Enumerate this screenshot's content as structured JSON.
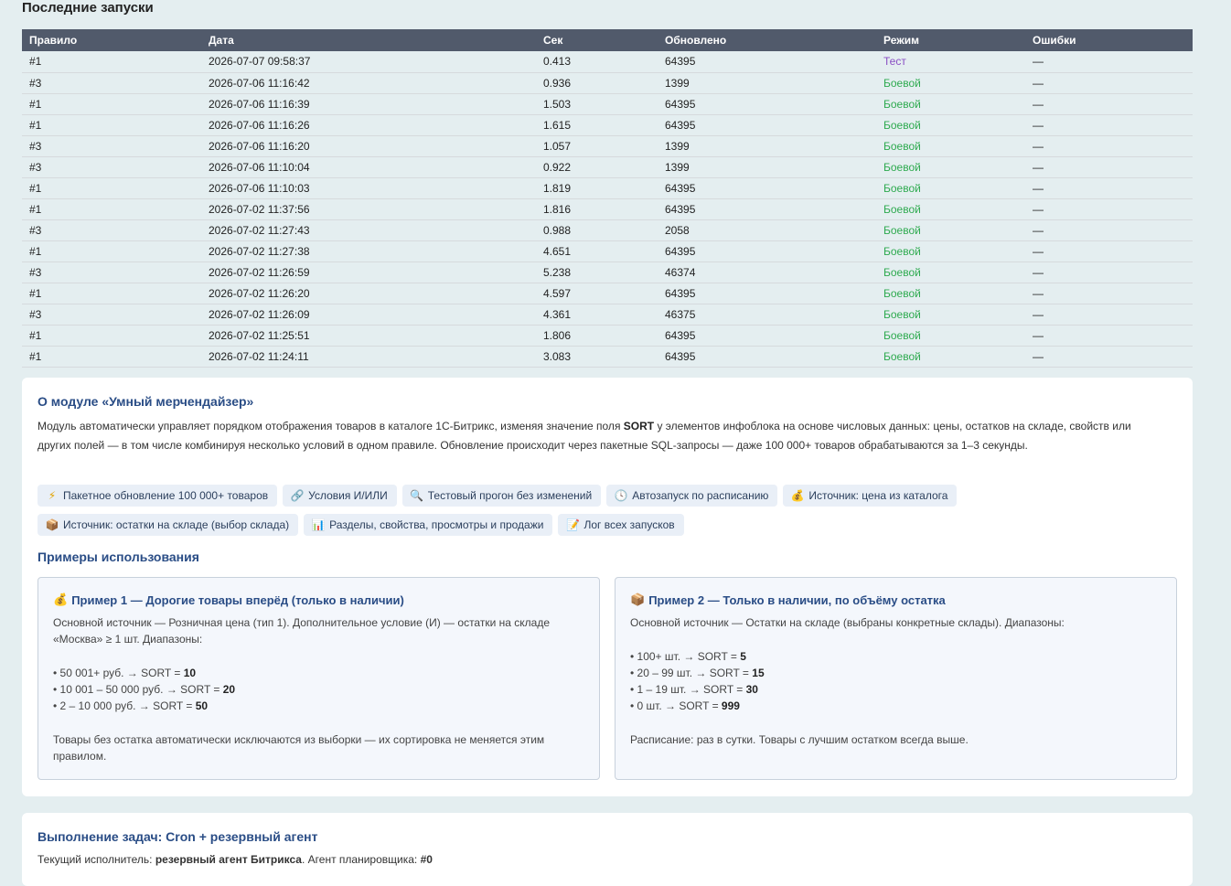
{
  "runs": {
    "title": "Последние запуски",
    "headers": [
      "Правило",
      "Дата",
      "Сек",
      "Обновлено",
      "Режим",
      "Ошибки"
    ],
    "rows": [
      {
        "rule": "#1",
        "date": "2026-07-07 09:58:37",
        "sec": "0.413",
        "updated": "64395",
        "mode": "Тест",
        "errors": "—"
      },
      {
        "rule": "#3",
        "date": "2026-07-06 11:16:42",
        "sec": "0.936",
        "updated": "1399",
        "mode": "Боевой",
        "errors": "—"
      },
      {
        "rule": "#1",
        "date": "2026-07-06 11:16:39",
        "sec": "1.503",
        "updated": "64395",
        "mode": "Боевой",
        "errors": "—"
      },
      {
        "rule": "#1",
        "date": "2026-07-06 11:16:26",
        "sec": "1.615",
        "updated": "64395",
        "mode": "Боевой",
        "errors": "—"
      },
      {
        "rule": "#3",
        "date": "2026-07-06 11:16:20",
        "sec": "1.057",
        "updated": "1399",
        "mode": "Боевой",
        "errors": "—"
      },
      {
        "rule": "#3",
        "date": "2026-07-06 11:10:04",
        "sec": "0.922",
        "updated": "1399",
        "mode": "Боевой",
        "errors": "—"
      },
      {
        "rule": "#1",
        "date": "2026-07-06 11:10:03",
        "sec": "1.819",
        "updated": "64395",
        "mode": "Боевой",
        "errors": "—"
      },
      {
        "rule": "#1",
        "date": "2026-07-02 11:37:56",
        "sec": "1.816",
        "updated": "64395",
        "mode": "Боевой",
        "errors": "—"
      },
      {
        "rule": "#3",
        "date": "2026-07-02 11:27:43",
        "sec": "0.988",
        "updated": "2058",
        "mode": "Боевой",
        "errors": "—"
      },
      {
        "rule": "#1",
        "date": "2026-07-02 11:27:38",
        "sec": "4.651",
        "updated": "64395",
        "mode": "Боевой",
        "errors": "—"
      },
      {
        "rule": "#3",
        "date": "2026-07-02 11:26:59",
        "sec": "5.238",
        "updated": "46374",
        "mode": "Боевой",
        "errors": "—"
      },
      {
        "rule": "#1",
        "date": "2026-07-02 11:26:20",
        "sec": "4.597",
        "updated": "64395",
        "mode": "Боевой",
        "errors": "—"
      },
      {
        "rule": "#3",
        "date": "2026-07-02 11:26:09",
        "sec": "4.361",
        "updated": "46375",
        "mode": "Боевой",
        "errors": "—"
      },
      {
        "rule": "#1",
        "date": "2026-07-02 11:25:51",
        "sec": "1.806",
        "updated": "64395",
        "mode": "Боевой",
        "errors": "—"
      },
      {
        "rule": "#1",
        "date": "2026-07-02 11:24:11",
        "sec": "3.083",
        "updated": "64395",
        "mode": "Боевой",
        "errors": "—"
      }
    ]
  },
  "about": {
    "title": "О модуле «Умный мерчендайзер»",
    "text_1": "Модуль автоматически управляет порядком отображения товаров в каталоге 1С-Битрикс, изменяя значение поля ",
    "text_bold": "SORT",
    "text_2": " у элементов инфоблока на основе числовых данных: цены, остатков на складе, свойств или других полей — в том числе комбинируя несколько условий в одном правиле. Обновление происходит через пакетные SQL-запросы — даже 100 000+ товаров обрабатываются за 1–3 секунды.",
    "tags": [
      {
        "icon": "lightning-icon",
        "label": "Пакетное обновление 100 000+ товаров"
      },
      {
        "icon": "link-icon",
        "label": "Условия И/ИЛИ"
      },
      {
        "icon": "magnifier-icon",
        "label": "Тестовый прогон без изменений"
      },
      {
        "icon": "clock-icon",
        "label": "Автозапуск по расписанию"
      },
      {
        "icon": "money-bag-icon",
        "label": "Источник: цена из каталога"
      },
      {
        "icon": "box-icon",
        "label": "Источник: остатки на складе (выбор склада)"
      },
      {
        "icon": "bar-chart-icon",
        "label": "Разделы, свойства, просмотры и продажи"
      },
      {
        "icon": "memo-icon",
        "label": "Лог всех запусков"
      }
    ]
  },
  "examples": {
    "title": "Примеры использования",
    "ex1": {
      "icon": "money-bag-icon",
      "title": "Пример 1 — Дорогие товары вперёд (только в наличии)",
      "intro": "Основной источник — Розничная цена (тип 1). Дополнительное условие (И) — остатки на складе «Москва» ≥ 1 шт. Диапазоны:",
      "lines": [
        {
          "text": "• 50 001+ руб. → SORT = ",
          "val": "10"
        },
        {
          "text": "• 10 001 – 50 000 руб. → SORT = ",
          "val": "20"
        },
        {
          "text": "• 2 – 10 000 руб. → SORT = ",
          "val": "50"
        }
      ],
      "note": "Товары без остатка автоматически исключаются из выборки — их сортировка не меняется этим правилом."
    },
    "ex2": {
      "icon": "box-icon",
      "title": "Пример 2 — Только в наличии, по объёму остатка",
      "intro": "Основной источник — Остатки на складе (выбраны конкретные склады). Диапазоны:",
      "lines": [
        {
          "text": "• 100+ шт. → SORT = ",
          "val": "5"
        },
        {
          "text": "• 20 – 99 шт. → SORT = ",
          "val": "15"
        },
        {
          "text": "• 1 – 19 шт. → SORT = ",
          "val": "30"
        },
        {
          "text": "• 0 шт. → SORT = ",
          "val": "999"
        }
      ],
      "note": "Расписание: раз в сутки. Товары с лучшим остатком всегда выше."
    }
  },
  "cron": {
    "title": "Выполнение задач: Cron + резервный агент",
    "text_1": "Текущий исполнитель: ",
    "text_bold_1": "резервный агент Битрикса",
    "text_2": ". Агент планировщика: ",
    "text_bold_2": "#0"
  },
  "colors": {
    "table_header": "#515a6b",
    "mode_test": "#8a4fc4",
    "mode_live": "#2eaa4f",
    "accent_title": "#2a4d86"
  }
}
